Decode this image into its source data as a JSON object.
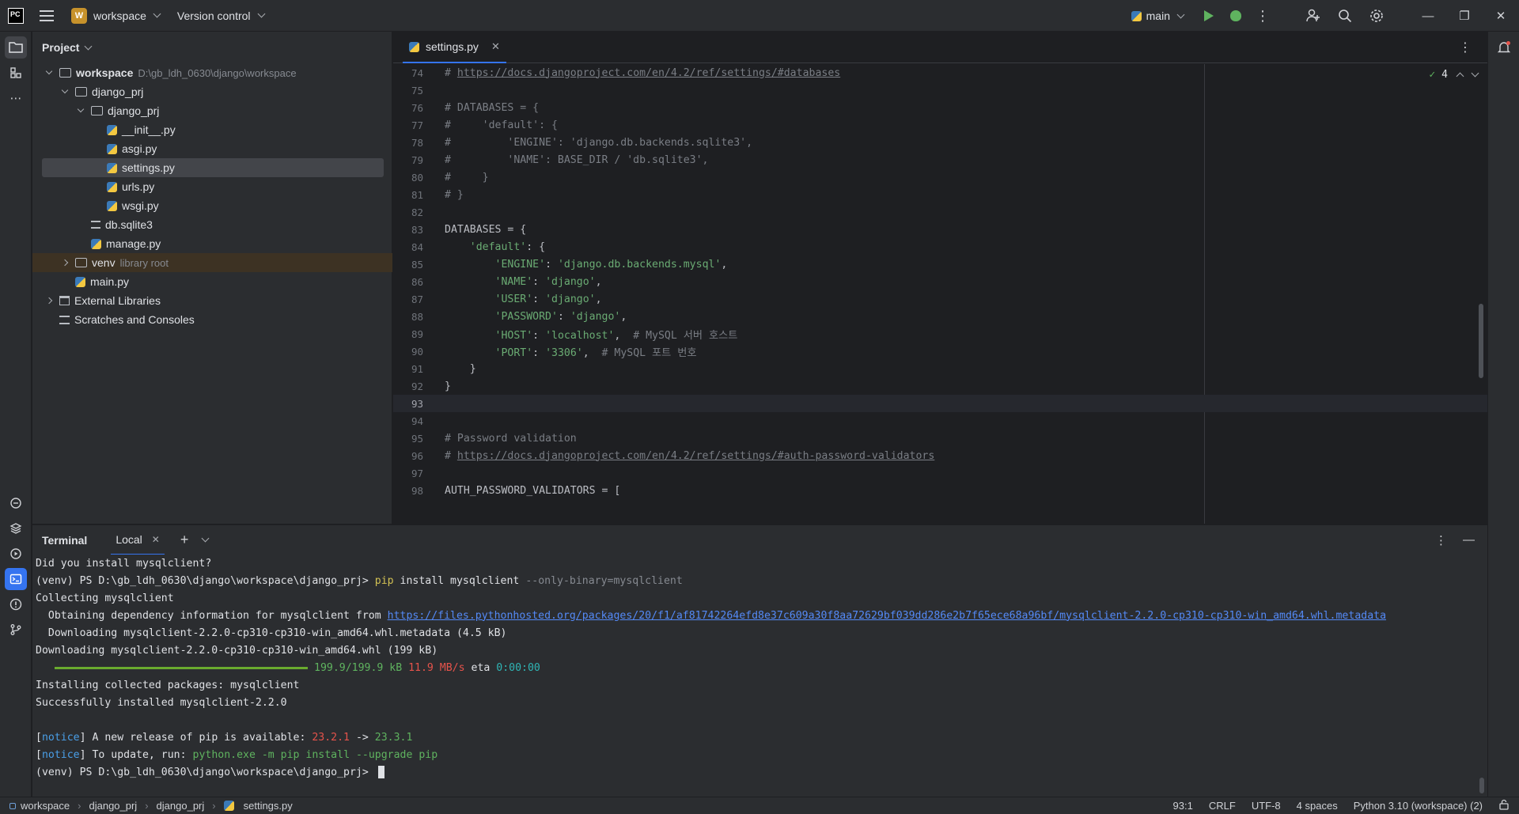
{
  "titlebar": {
    "logo": "PC",
    "project_badge": "W",
    "project_name": "workspace",
    "vcs": "Version control",
    "run_config": "main"
  },
  "project_panel": {
    "title": "Project",
    "tree": [
      {
        "label": "workspace",
        "hint": "D:\\gb_ldh_0630\\django\\workspace",
        "type": "folder",
        "indent": 0,
        "expanded": true,
        "bold": true
      },
      {
        "label": "django_prj",
        "type": "folder",
        "indent": 1,
        "expanded": true
      },
      {
        "label": "django_prj",
        "type": "package",
        "indent": 2,
        "expanded": true
      },
      {
        "label": "__init__.py",
        "type": "py",
        "indent": 3
      },
      {
        "label": "asgi.py",
        "type": "py",
        "indent": 3
      },
      {
        "label": "settings.py",
        "type": "py",
        "indent": 3,
        "selected": true
      },
      {
        "label": "urls.py",
        "type": "py",
        "indent": 3
      },
      {
        "label": "wsgi.py",
        "type": "py",
        "indent": 3
      },
      {
        "label": "db.sqlite3",
        "type": "db",
        "indent": 2
      },
      {
        "label": "manage.py",
        "type": "py",
        "indent": 2
      },
      {
        "label": "venv",
        "hint": "library root",
        "type": "folder",
        "indent": 1,
        "expanded": false,
        "excluded": true
      },
      {
        "label": "main.py",
        "type": "py",
        "indent": 1
      },
      {
        "label": "External Libraries",
        "type": "lib",
        "indent": 0,
        "expanded": false
      },
      {
        "label": "Scratches and Consoles",
        "type": "scratch",
        "indent": 0
      }
    ]
  },
  "editor": {
    "tab": "settings.py",
    "inspection_count": "4",
    "current_line": "93",
    "lines": [
      {
        "n": "74",
        "parts": [
          [
            "cm",
            "# "
          ],
          [
            "cm-link",
            "https://docs.djangoproject.com/en/4.2/ref/settings/#databases"
          ]
        ]
      },
      {
        "n": "75",
        "parts": []
      },
      {
        "n": "76",
        "parts": [
          [
            "cm",
            "# DATABASES = {"
          ]
        ]
      },
      {
        "n": "77",
        "parts": [
          [
            "cm",
            "#     'default': {"
          ]
        ]
      },
      {
        "n": "78",
        "parts": [
          [
            "cm",
            "#         'ENGINE': 'django.db.backends.sqlite3',"
          ]
        ]
      },
      {
        "n": "79",
        "parts": [
          [
            "cm",
            "#         'NAME': BASE_DIR / 'db.sqlite3',"
          ]
        ]
      },
      {
        "n": "80",
        "parts": [
          [
            "cm",
            "#     }"
          ]
        ]
      },
      {
        "n": "81",
        "parts": [
          [
            "cm",
            "# }"
          ]
        ]
      },
      {
        "n": "82",
        "parts": []
      },
      {
        "n": "83",
        "parts": [
          [
            "",
            "DATABASES = {"
          ]
        ]
      },
      {
        "n": "84",
        "parts": [
          [
            "",
            "    "
          ],
          [
            "str",
            "'default'"
          ],
          [
            "",
            ": {"
          ]
        ]
      },
      {
        "n": "85",
        "parts": [
          [
            "",
            "        "
          ],
          [
            "str",
            "'ENGINE'"
          ],
          [
            "",
            ": "
          ],
          [
            "str",
            "'django.db.backends.mysql'"
          ],
          [
            "",
            ","
          ]
        ]
      },
      {
        "n": "86",
        "parts": [
          [
            "",
            "        "
          ],
          [
            "str",
            "'NAME'"
          ],
          [
            "",
            ": "
          ],
          [
            "str",
            "'django'"
          ],
          [
            "",
            ","
          ]
        ]
      },
      {
        "n": "87",
        "parts": [
          [
            "",
            "        "
          ],
          [
            "str",
            "'USER'"
          ],
          [
            "",
            ": "
          ],
          [
            "str",
            "'django'"
          ],
          [
            "",
            ","
          ]
        ]
      },
      {
        "n": "88",
        "parts": [
          [
            "",
            "        "
          ],
          [
            "str",
            "'PASSWORD'"
          ],
          [
            "",
            ": "
          ],
          [
            "str",
            "'django'"
          ],
          [
            "",
            ","
          ]
        ]
      },
      {
        "n": "89",
        "parts": [
          [
            "",
            "        "
          ],
          [
            "str",
            "'HOST'"
          ],
          [
            "",
            ": "
          ],
          [
            "str",
            "'localhost'"
          ],
          [
            "",
            ",  "
          ],
          [
            "cm",
            "# MySQL 서버 호스트"
          ]
        ]
      },
      {
        "n": "90",
        "parts": [
          [
            "",
            "        "
          ],
          [
            "str",
            "'PORT'"
          ],
          [
            "",
            ": "
          ],
          [
            "str",
            "'3306'"
          ],
          [
            "",
            ",  "
          ],
          [
            "cm",
            "# MySQL 포트 번호"
          ]
        ]
      },
      {
        "n": "91",
        "parts": [
          [
            "",
            "    }"
          ]
        ]
      },
      {
        "n": "92",
        "parts": [
          [
            "",
            "}"
          ]
        ]
      },
      {
        "n": "93",
        "parts": []
      },
      {
        "n": "94",
        "parts": []
      },
      {
        "n": "95",
        "parts": [
          [
            "cm",
            "# Password validation"
          ]
        ]
      },
      {
        "n": "96",
        "parts": [
          [
            "cm",
            "# "
          ],
          [
            "cm-link",
            "https://docs.djangoproject.com/en/4.2/ref/settings/#auth-password-validators"
          ]
        ]
      },
      {
        "n": "97",
        "parts": []
      },
      {
        "n": "98",
        "parts": [
          [
            "",
            "AUTH_PASSWORD_VALIDATORS = ["
          ]
        ]
      }
    ]
  },
  "terminal": {
    "title": "Terminal",
    "tab": "Local",
    "lines": [
      [
        [
          "",
          "Did you install mysqlclient?"
        ]
      ],
      [
        [
          "",
          "(venv) PS D:\\gb_ldh_0630\\django\\workspace\\django_prj> "
        ],
        [
          "t-yellow",
          "pip"
        ],
        [
          "",
          " install mysqlclient "
        ],
        [
          "t-gray",
          "--only-binary=mysqlclient"
        ]
      ],
      [
        [
          "",
          "Collecting mysqlclient"
        ]
      ],
      [
        [
          "",
          "  Obtaining dependency information for mysqlclient from "
        ],
        [
          "t-link",
          "https://files.pythonhosted.org/packages/20/f1/af81742264efd8e37c609a30f8aa72629bf039dd286e2b7f65ece68a96bf/mysqlclient-2.2.0-cp310-cp310-win_amd64.whl.metadata"
        ]
      ],
      [
        [
          "",
          "  Downloading mysqlclient-2.2.0-cp310-cp310-win_amd64.whl.metadata (4.5 kB)"
        ]
      ],
      [
        [
          "",
          "Downloading mysqlclient-2.2.0-cp310-cp310-win_amd64.whl (199 kB)"
        ]
      ],
      [
        [
          "progress",
          ""
        ],
        [
          "t-green",
          "199.9/199.9 kB"
        ],
        [
          "",
          " "
        ],
        [
          "t-red",
          "11.9 MB/s"
        ],
        [
          "",
          " eta "
        ],
        [
          "t-cyan",
          "0:00:00"
        ]
      ],
      [
        [
          "",
          "Installing collected packages: mysqlclient"
        ]
      ],
      [
        [
          "",
          "Successfully installed mysqlclient-2.2.0"
        ]
      ],
      [],
      [
        [
          "",
          "["
        ],
        [
          "t-blue",
          "notice"
        ],
        [
          "",
          "] A new release of pip is available: "
        ],
        [
          "t-red",
          "23.2.1"
        ],
        [
          "",
          " -> "
        ],
        [
          "t-green",
          "23.3.1"
        ]
      ],
      [
        [
          "",
          "["
        ],
        [
          "t-blue",
          "notice"
        ],
        [
          "",
          "] To update, run: "
        ],
        [
          "t-green",
          "python.exe -m pip install --upgrade pip"
        ]
      ],
      [
        [
          "",
          "(venv) PS D:\\gb_ldh_0630\\django\\workspace\\django_prj> "
        ],
        [
          "cursor",
          ""
        ]
      ]
    ],
    "download_progress": 1.0
  },
  "statusbar": {
    "crumbs": [
      "workspace",
      "django_prj",
      "django_prj",
      "settings.py"
    ],
    "position": "93:1",
    "line_sep": "CRLF",
    "encoding": "UTF-8",
    "indent": "4 spaces",
    "interpreter": "Python 3.10 (workspace) (2)"
  }
}
